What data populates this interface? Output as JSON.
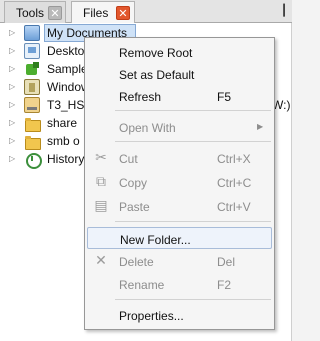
{
  "tabs": [
    {
      "label": "Tools",
      "close_icon": "close-icon",
      "active": false
    },
    {
      "label": "Files",
      "close_icon": "close-icon",
      "active": true
    }
  ],
  "pin_icon": "pin-icon",
  "tree": {
    "items": [
      {
        "label": "My Documents",
        "icon": "documents-icon",
        "selected": true
      },
      {
        "label": "Desktop",
        "icon": "desktop-icon"
      },
      {
        "label": "Samples",
        "icon": "samples-icon"
      },
      {
        "label": "Windows",
        "icon": "windows-icon"
      },
      {
        "label": "T3_HS",
        "icon": "drive-icon"
      },
      {
        "label": "share",
        "icon": "folder-icon"
      },
      {
        "label": "smb o",
        "icon": "folder-icon"
      },
      {
        "label": "History",
        "icon": "history-icon"
      }
    ],
    "obscured_suffix": "W:)"
  },
  "context_menu": {
    "items": [
      {
        "label": "Remove Root",
        "shortcut": "",
        "enabled": true
      },
      {
        "label": "Set as Default",
        "shortcut": "",
        "enabled": true
      },
      {
        "label": "Refresh",
        "shortcut": "F5",
        "enabled": true
      },
      {
        "label": "Open With",
        "shortcut": "",
        "enabled": false,
        "submenu": true
      },
      {
        "label": "Cut",
        "shortcut": "Ctrl+X",
        "enabled": false,
        "icon": "scissors-icon"
      },
      {
        "label": "Copy",
        "shortcut": "Ctrl+C",
        "enabled": false,
        "icon": "copy-icon"
      },
      {
        "label": "Paste",
        "shortcut": "Ctrl+V",
        "enabled": false,
        "icon": "paste-icon"
      },
      {
        "label": "New Folder...",
        "shortcut": "",
        "enabled": true,
        "highlighted": true
      },
      {
        "label": "Delete",
        "shortcut": "Del",
        "enabled": false,
        "icon": "delete-icon"
      },
      {
        "label": "Rename",
        "shortcut": "F2",
        "enabled": false
      },
      {
        "label": "Properties...",
        "shortcut": "",
        "enabled": true
      }
    ]
  },
  "colors": {
    "selection_bg": "#cfe2f7",
    "selection_border": "#86a9d4",
    "files_close": "#e2572d",
    "disabled_text": "#8d8d8d"
  }
}
